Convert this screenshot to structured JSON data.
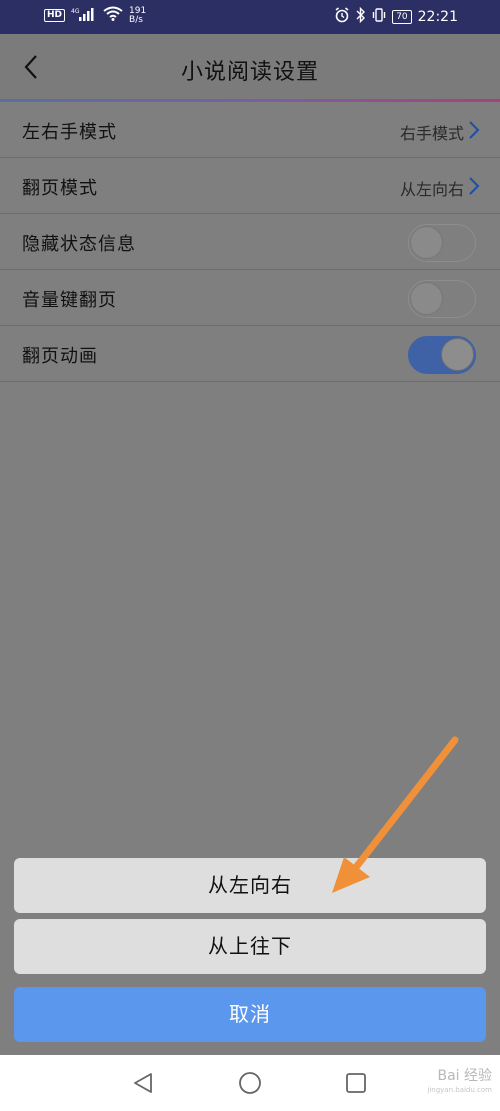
{
  "status_bar": {
    "hd": "HD",
    "signal_gen": "4G",
    "net_speed_value": "191",
    "net_speed_unit": "B/s",
    "battery": "70",
    "time": "22:21"
  },
  "header": {
    "title": "小说阅读设置"
  },
  "settings": [
    {
      "label": "左右手模式",
      "value": "右手模式",
      "type": "select"
    },
    {
      "label": "翻页模式",
      "value": "从左向右",
      "type": "select"
    },
    {
      "label": "隐藏状态信息",
      "type": "toggle",
      "on": false
    },
    {
      "label": "音量键翻页",
      "type": "toggle",
      "on": false
    },
    {
      "label": "翻页动画",
      "type": "toggle",
      "on": true
    }
  ],
  "sheet": {
    "options": [
      "从左向右",
      "从上往下"
    ],
    "cancel": "取消"
  },
  "colors": {
    "status_bar": "#2c2f63",
    "toggle_on": "#3f62a6",
    "cancel_button": "#5b97ec",
    "arrow": "#f0913a"
  },
  "watermark": {
    "text": "Bai 经验",
    "sub": "jingyan.baidu.com"
  }
}
